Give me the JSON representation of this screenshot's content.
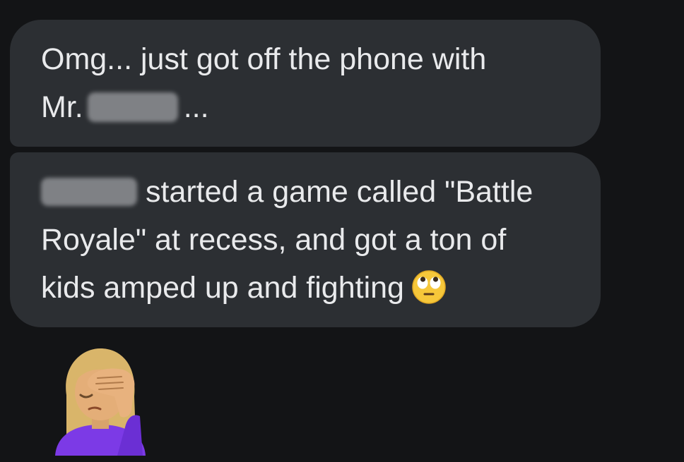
{
  "messages": [
    {
      "line1": "Omg... just got off the phone with",
      "line2_prefix": "Mr.",
      "line2_suffix": "..."
    },
    {
      "line1_suffix": "started a game called \"Battle",
      "line2": "Royale\" at recess, and got a ton of",
      "line3": "kids amped up and fighting",
      "trailing_emoji": "face-with-rolling-eyes-icon"
    }
  ],
  "reaction_emoji": "person-facepalming-icon",
  "colors": {
    "background": "#131416",
    "bubble": "#2c2f33",
    "text": "#e9eaec",
    "redaction": "#8e9094"
  }
}
